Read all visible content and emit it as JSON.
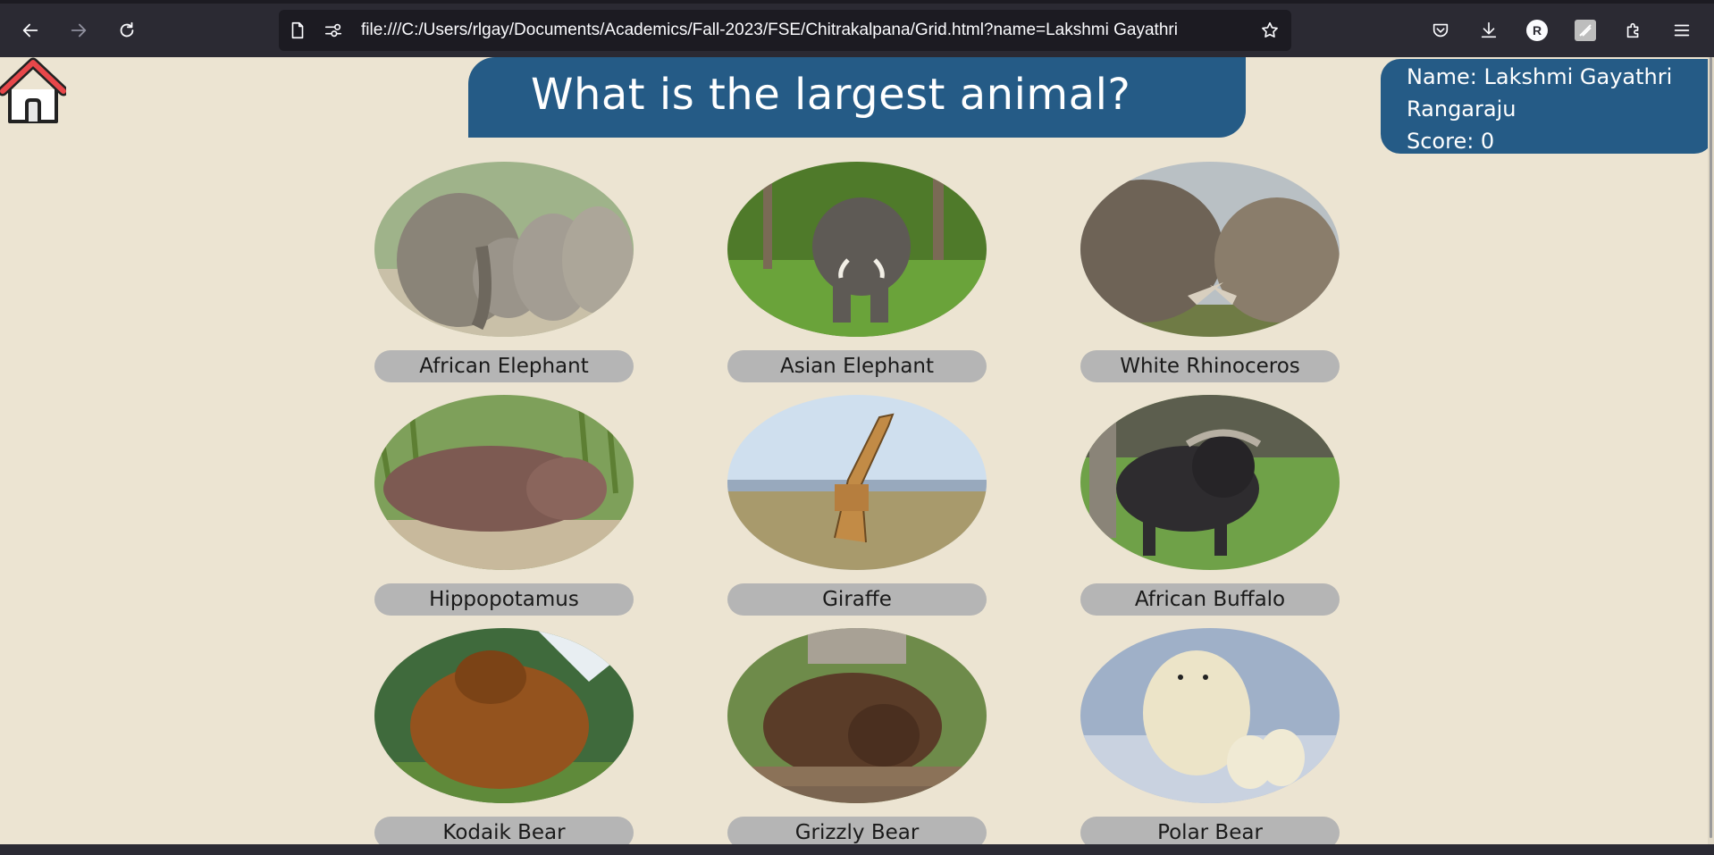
{
  "browser": {
    "url": "file:///C:/Users/rlgay/Documents/Academics/Fall-2023/FSE/Chitrakalpana/Grid.html?name=Lakshmi Gayathri",
    "profile_initial": "R",
    "icons": [
      "back-icon",
      "forward-icon",
      "reload-icon",
      "page-icon",
      "site-permissions-icon",
      "bookmark-star-icon",
      "pocket-icon",
      "downloads-icon",
      "profile-icon",
      "extension-icon",
      "extensions-puzzle-icon",
      "menu-icon"
    ]
  },
  "header": {
    "title": "What is the largest animal?"
  },
  "player": {
    "name_line1": "Name: Lakshmi Gayathri",
    "name_line2": "Rangaraju",
    "score_line": "Score: 0"
  },
  "animals": [
    {
      "label": "African Elephant"
    },
    {
      "label": "Asian Elephant"
    },
    {
      "label": "White Rhinoceros"
    },
    {
      "label": "Hippopotamus"
    },
    {
      "label": "Giraffe"
    },
    {
      "label": "African Buffalo"
    },
    {
      "label": "Kodaik Bear"
    },
    {
      "label": "Grizzly Bear"
    },
    {
      "label": "Polar Bear"
    }
  ],
  "colors": {
    "page_bg": "#ece4d2",
    "banner_blue": "#255b86",
    "label_gray": "#b5b5b5",
    "home_roof_red": "#e8474a"
  }
}
